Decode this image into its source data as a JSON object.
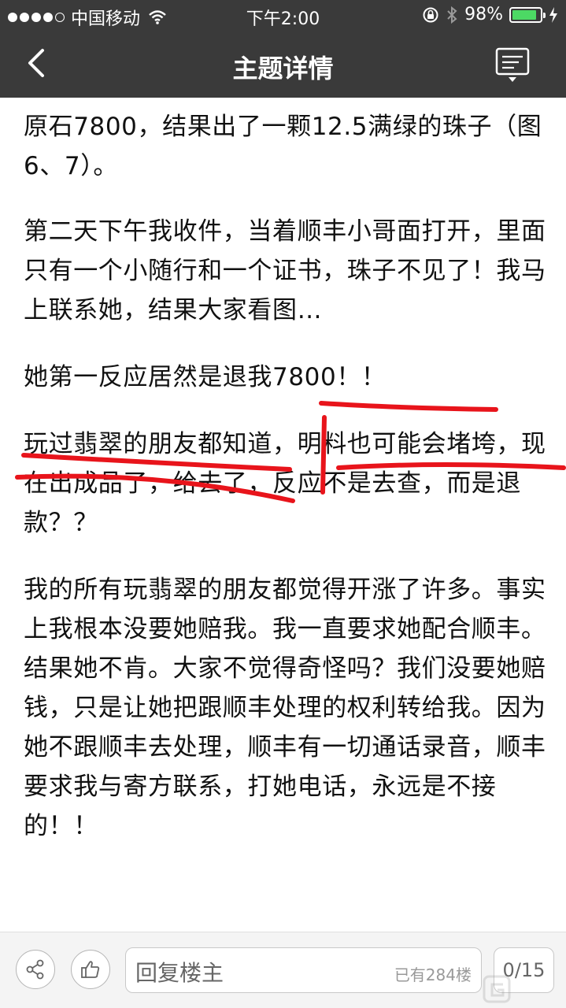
{
  "status": {
    "carrier": "中国移动",
    "time": "下午2:00",
    "battery": "98%",
    "battery_level": 0.98
  },
  "nav": {
    "title": "主题详情",
    "icons": [
      "back-arrow-icon",
      "message-menu-icon"
    ]
  },
  "post": {
    "paragraphs": [
      "原石7800，结果出了一颗12.5满绿的珠子（图6、7）。",
      "第二天下午我收件，当着顺丰小哥面打开，里面只有一个小随行和一个证书，珠子不见了！我马上联系她，结果大家看图…",
      "她第一反应居然是退我7800！！",
      "玩过翡翠的朋友都知道，明料也可能会堵垮，现在出成品了，给去了，反应不是去查，而是退款？？",
      "我的所有玩翡翠的朋友都觉得开涨了许多。事实上我根本没要她赔我。我一直要求她配合顺丰。结果她不肯。大家不觉得奇怪吗？我们没要她赔钱，只是让她把跟顺丰处理的权利转给我。因为她不跟顺丰去处理，顺丰有一切通话录音，顺丰要求我与寄方联系，打她电话，永远是不接的！！"
    ],
    "annotation_color": "#e8141b"
  },
  "footer": {
    "reply_placeholder": "回复楼主",
    "reply_count": "已有284楼",
    "page": "0/15",
    "icons": [
      "share-icon",
      "like-icon"
    ]
  }
}
